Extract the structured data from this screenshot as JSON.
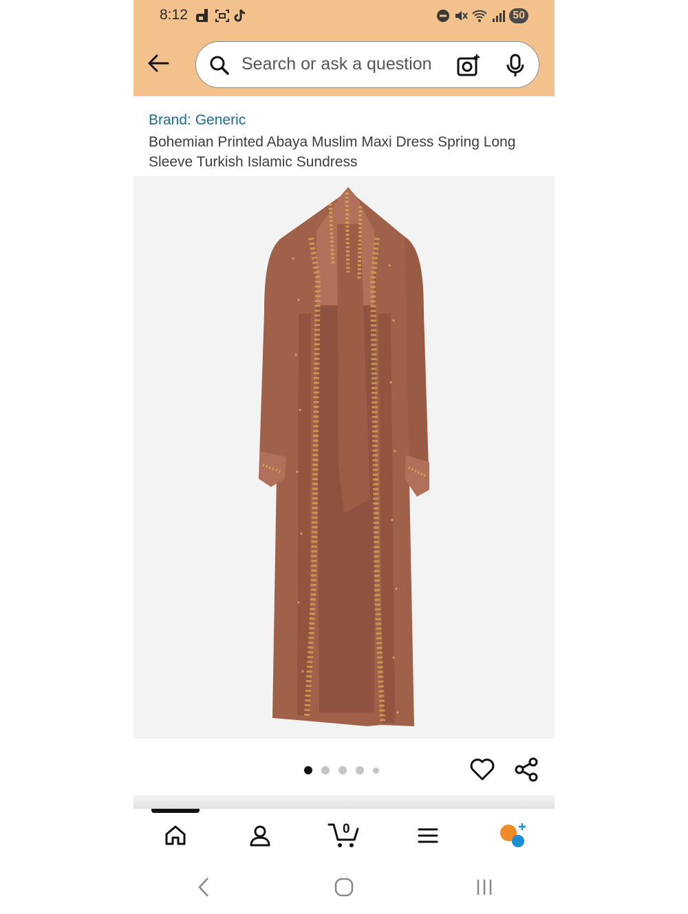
{
  "status_bar": {
    "time": "8:12",
    "battery": "50",
    "icons": [
      "d-app-icon",
      "screenshot-icon",
      "tiktok-icon",
      "do-not-disturb-icon",
      "mute-icon",
      "wifi-icon",
      "signal-icon"
    ]
  },
  "search": {
    "placeholder": "Search or ask a question"
  },
  "product": {
    "brand": "Brand: Generic",
    "title": "Bohemian Printed Abaya Muslim Maxi Dress Spring Long Sleeve Turkish Islamic Sundress",
    "image_count": 5,
    "active_image": 1
  },
  "cart": {
    "count": "0"
  },
  "colors": {
    "header_bg": "#f2c18c",
    "brand_link": "#1c6a8e",
    "dress_main": "#a0614a",
    "dress_shadow": "#7e4634",
    "embroidery": "#d4a457"
  }
}
